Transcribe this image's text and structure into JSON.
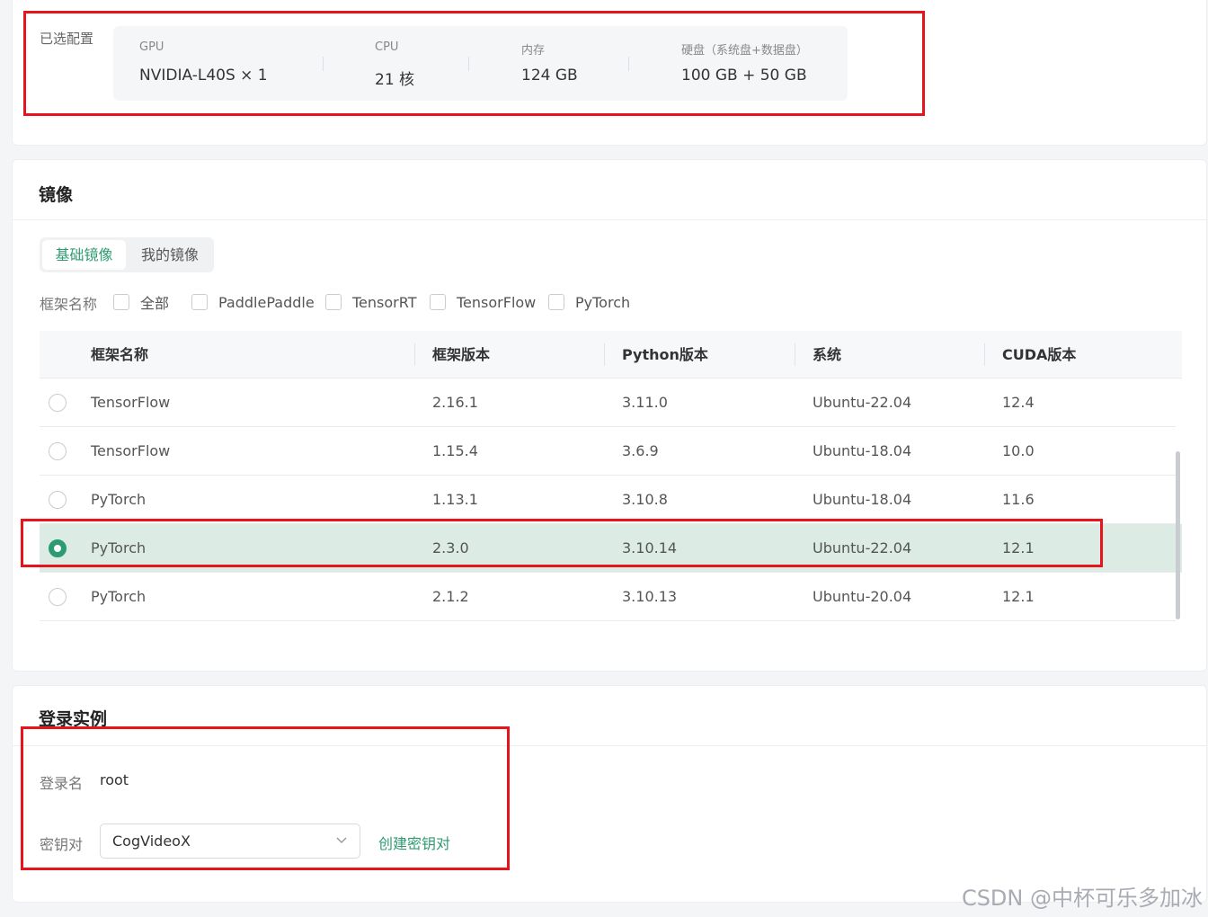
{
  "config": {
    "label": "已选配置",
    "items": [
      {
        "key": "GPU",
        "value": "NVIDIA-L40S × 1"
      },
      {
        "key": "CPU",
        "value": "21 核"
      },
      {
        "key": "内存",
        "value": "124 GB"
      },
      {
        "key": "硬盘（系统盘+数据盘）",
        "value": "100 GB + 50 GB"
      }
    ]
  },
  "image": {
    "title": "镜像",
    "tabs": [
      {
        "label": "基础镜像",
        "active": true
      },
      {
        "label": "我的镜像",
        "active": false
      }
    ],
    "filter": {
      "label": "框架名称",
      "options": [
        "全部",
        "PaddlePaddle",
        "TensorRT",
        "TensorFlow",
        "PyTorch"
      ]
    },
    "table": {
      "columns": [
        "框架名称",
        "框架版本",
        "Python版本",
        "系统",
        "CUDA版本"
      ],
      "rows": [
        {
          "framework": "TensorFlow",
          "version": "2.16.1",
          "python": "3.11.0",
          "os": "Ubuntu-22.04",
          "cuda": "12.4",
          "selected": false
        },
        {
          "framework": "TensorFlow",
          "version": "1.15.4",
          "python": "3.6.9",
          "os": "Ubuntu-18.04",
          "cuda": "10.0",
          "selected": false
        },
        {
          "framework": "PyTorch",
          "version": "1.13.1",
          "python": "3.10.8",
          "os": "Ubuntu-18.04",
          "cuda": "11.6",
          "selected": false
        },
        {
          "framework": "PyTorch",
          "version": "2.3.0",
          "python": "3.10.14",
          "os": "Ubuntu-22.04",
          "cuda": "12.1",
          "selected": true
        },
        {
          "framework": "PyTorch",
          "version": "2.1.2",
          "python": "3.10.13",
          "os": "Ubuntu-20.04",
          "cuda": "12.1",
          "selected": false
        }
      ]
    }
  },
  "login": {
    "title": "登录实例",
    "username_label": "登录名",
    "username_value": "root",
    "keypair_label": "密钥对",
    "keypair_value": "CogVideoX",
    "create_keypair_link": "创建密钥对"
  },
  "watermark": "CSDN @中杯可乐多加冰",
  "colors": {
    "accent": "#2e9a72",
    "selected_row": "#dcebe3",
    "annotation_red": "#e8141c"
  }
}
